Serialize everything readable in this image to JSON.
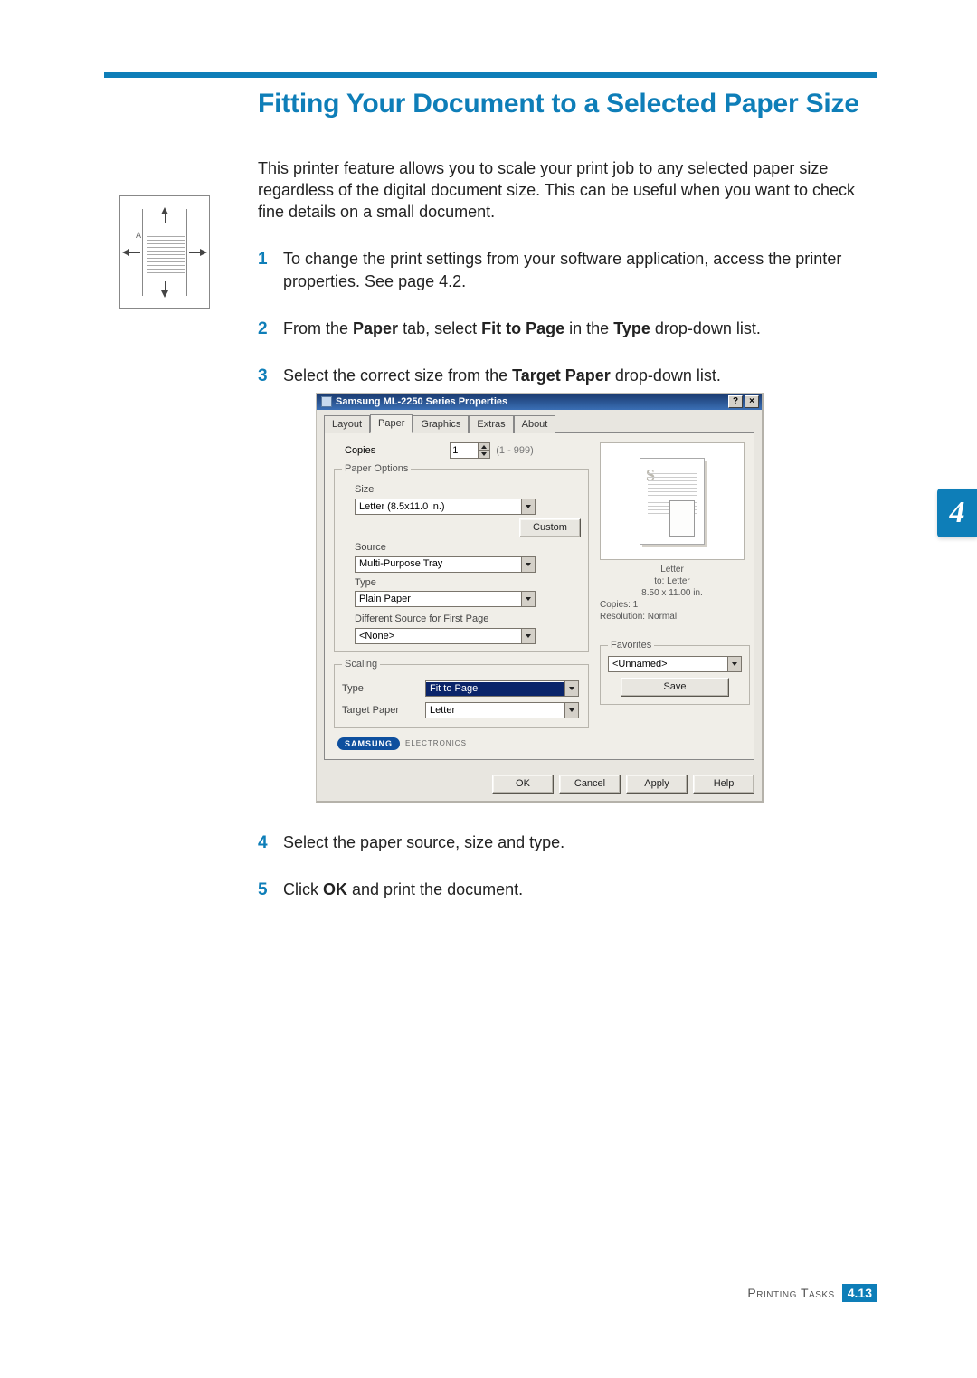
{
  "header": {
    "title": "Fitting Your Document to a Selected Paper Size"
  },
  "sideicon": {
    "label": "A"
  },
  "intro": "This printer feature allows you to scale your print job to any selected paper size regardless of the digital document size. This can be useful when you want to check fine details on a small document.",
  "steps": {
    "s1": {
      "num": "1",
      "text_a": "To change the print settings from your software application, access the printer properties. See page 4.2."
    },
    "s2": {
      "num": "2",
      "prefix": "From the ",
      "b1": "Paper",
      "mid1": " tab, select ",
      "b2": "Fit to Page",
      "mid2": " in the ",
      "b3": "Type",
      "suffix": " drop-down list."
    },
    "s3": {
      "num": "3",
      "prefix": "Select the correct size from the ",
      "b1": "Target Paper",
      "suffix": " drop-down list."
    },
    "s4": {
      "num": "4",
      "text": "Select the paper source, size and type."
    },
    "s5": {
      "num": "5",
      "prefix": "Click ",
      "b1": "OK",
      "suffix": " and print the document."
    }
  },
  "dialog": {
    "title": "Samsung ML-2250 Series Properties",
    "help_btn": "?",
    "close_btn": "×",
    "tabs": {
      "layout": "Layout",
      "paper": "Paper",
      "graphics": "Graphics",
      "extras": "Extras",
      "about": "About"
    },
    "copies": {
      "label": "Copies",
      "value": "1",
      "range": "(1 - 999)"
    },
    "paperoptions": {
      "legend": "Paper Options",
      "size_label": "Size",
      "size_value": "Letter (8.5x11.0 in.)",
      "custom_btn": "Custom",
      "source_label": "Source",
      "source_value": "Multi-Purpose Tray",
      "type_label": "Type",
      "type_value": "Plain Paper",
      "diffsrc_label": "Different Source for First Page",
      "diffsrc_value": "<None>"
    },
    "scaling": {
      "legend": "Scaling",
      "type_label": "Type",
      "type_value": "Fit to Page",
      "target_label": "Target Paper",
      "target_value": "Letter"
    },
    "preview": {
      "line1": "Letter",
      "line2": "to: Letter",
      "line3": "8.50 x 11.00 in.",
      "line4": "Copies: 1",
      "line5": "Resolution: Normal"
    },
    "favorites": {
      "legend": "Favorites",
      "value": "<Unnamed>",
      "save_btn": "Save"
    },
    "logo": {
      "brand": "SAMSUNG",
      "sub": "ELECTRONICS"
    },
    "buttons": {
      "ok": "OK",
      "cancel": "Cancel",
      "apply": "Apply",
      "help": "Help"
    }
  },
  "chapter_tab": "4",
  "footer": {
    "section": "Printing Tasks",
    "chapter": "4.",
    "page": "13"
  }
}
